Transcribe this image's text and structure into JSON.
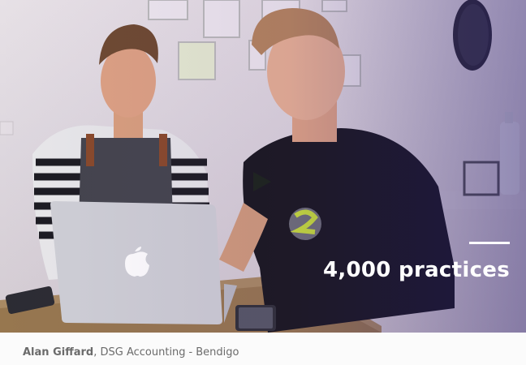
{
  "video": {
    "stat_text": "4,000 practices",
    "play_icon": "play-icon",
    "overlay_color": "#3b2a7a"
  },
  "caption": {
    "name": "Alan Giffard",
    "company": "DSG Accounting",
    "separator": "-",
    "location": "Bendigo"
  }
}
